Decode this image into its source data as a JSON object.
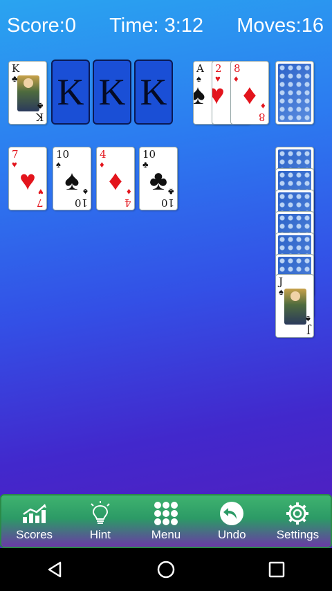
{
  "status": {
    "score": "Score:0",
    "time": "Time: 3:12",
    "moves": "Moves:16"
  },
  "foundations": [
    {
      "rank": "K",
      "suit": "♣",
      "color": "black",
      "type": "face"
    },
    {
      "label": "K"
    },
    {
      "label": "K"
    },
    {
      "label": "K"
    }
  ],
  "waste": [
    {
      "rank": "A",
      "suit": "♠",
      "color": "black"
    },
    {
      "rank": "2",
      "suit": "♥",
      "color": "red"
    },
    {
      "rank": "8",
      "suit": "♦",
      "color": "red"
    }
  ],
  "tableau": [
    {
      "rank": "7",
      "suit": "♥",
      "color": "red"
    },
    {
      "rank": "10",
      "suit": "♠",
      "color": "black"
    },
    {
      "rank": "4",
      "suit": "♦",
      "color": "red"
    },
    {
      "rank": "10",
      "suit": "♣",
      "color": "black"
    }
  ],
  "right_column": {
    "face_down_count": 6,
    "top_card": {
      "rank": "J",
      "suit": "♠",
      "color": "black",
      "type": "face"
    }
  },
  "toolbar": [
    {
      "label": "Scores",
      "icon": "chart-icon"
    },
    {
      "label": "Hint",
      "icon": "lightbulb-icon"
    },
    {
      "label": "Menu",
      "icon": "grid-icon"
    },
    {
      "label": "Undo",
      "icon": "undo-icon"
    },
    {
      "label": "Settings",
      "icon": "gear-icon"
    }
  ],
  "nav": [
    "back-icon",
    "home-icon",
    "recents-icon"
  ],
  "colors": {
    "background_top": "#2aa4f0",
    "background_bottom": "#5a1ab8",
    "foundation": "#1a4fd6",
    "toolbar_green": "#3fb36f",
    "red_suit": "#e3141c"
  }
}
